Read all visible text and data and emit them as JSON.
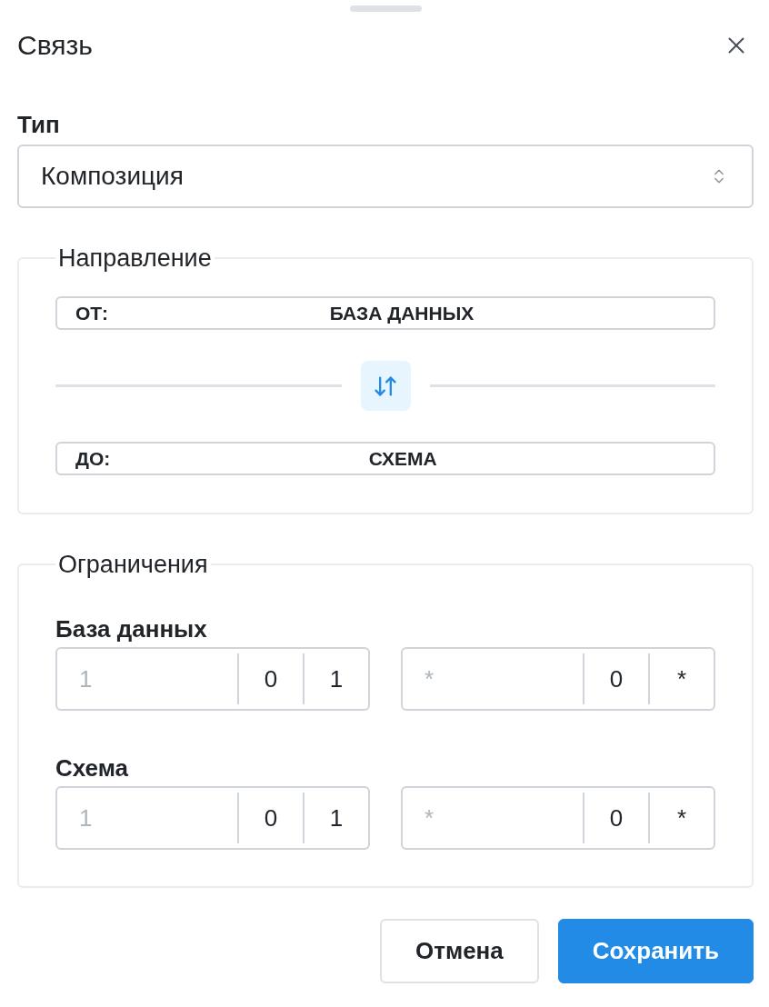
{
  "sheet": {
    "title": "Связь"
  },
  "type_field": {
    "label": "Тип",
    "value": "Композиция"
  },
  "direction": {
    "legend": "Направление",
    "rows": [
      {
        "label": "ОТ:",
        "value": "БАЗА ДАННЫХ"
      },
      {
        "label": "ДО:",
        "value": "СХЕМА"
      }
    ]
  },
  "constraints": {
    "legend": "Ограничения",
    "groups": [
      {
        "label": "База данных",
        "fields": [
          {
            "placeholder": "1",
            "options": [
              "0",
              "1"
            ]
          },
          {
            "placeholder": "*",
            "options": [
              "0",
              "*"
            ]
          }
        ]
      },
      {
        "label": "Схема",
        "fields": [
          {
            "placeholder": "1",
            "options": [
              "0",
              "1"
            ]
          },
          {
            "placeholder": "*",
            "options": [
              "0",
              "*"
            ]
          }
        ]
      }
    ]
  },
  "buttons": [
    {
      "label": "Отмена",
      "kind": "secondary"
    },
    {
      "label": "Сохранить",
      "kind": "primary"
    }
  ]
}
